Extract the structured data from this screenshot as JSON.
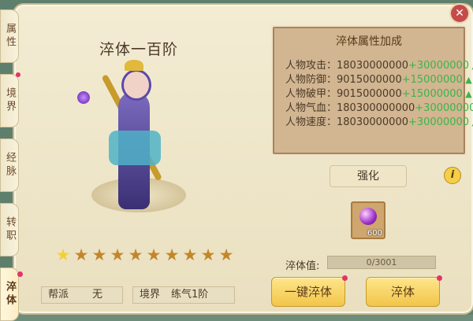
{
  "window": {
    "close_glyph": "✕"
  },
  "tabs": [
    {
      "label": "属性"
    },
    {
      "label": "境界"
    },
    {
      "label": "经脉"
    },
    {
      "label": "转职"
    },
    {
      "label": "淬体"
    }
  ],
  "title": "淬体一百阶",
  "stars": {
    "filled": 1,
    "total": 10
  },
  "info_bar": {
    "faction_label": "帮派",
    "faction_value": "无",
    "realm_label": "境界",
    "realm_value": "练气1阶"
  },
  "attributes": {
    "heading": "淬体属性加成",
    "rows": [
      {
        "label": "人物攻击：",
        "value": "18030000000",
        "bonus": "+30000000"
      },
      {
        "label": "人物防御：",
        "value": "9015000000",
        "bonus": "+15000000"
      },
      {
        "label": "人物破甲：",
        "value": "9015000000",
        "bonus": "+15000000"
      },
      {
        "label": "人物气血：",
        "value": "180300000000",
        "bonus": "+300000000"
      },
      {
        "label": "人物速度：",
        "value": "18030000000",
        "bonus": "+30000000"
      }
    ]
  },
  "enhance_label": "强化",
  "info_icon": "i",
  "item": {
    "icon": "purple-gem-icon",
    "count": "600"
  },
  "progress": {
    "label": "淬体值:",
    "text": "0/3001",
    "fraction": 0
  },
  "buttons": {
    "one_click": "一键淬体",
    "temper": "淬体"
  }
}
